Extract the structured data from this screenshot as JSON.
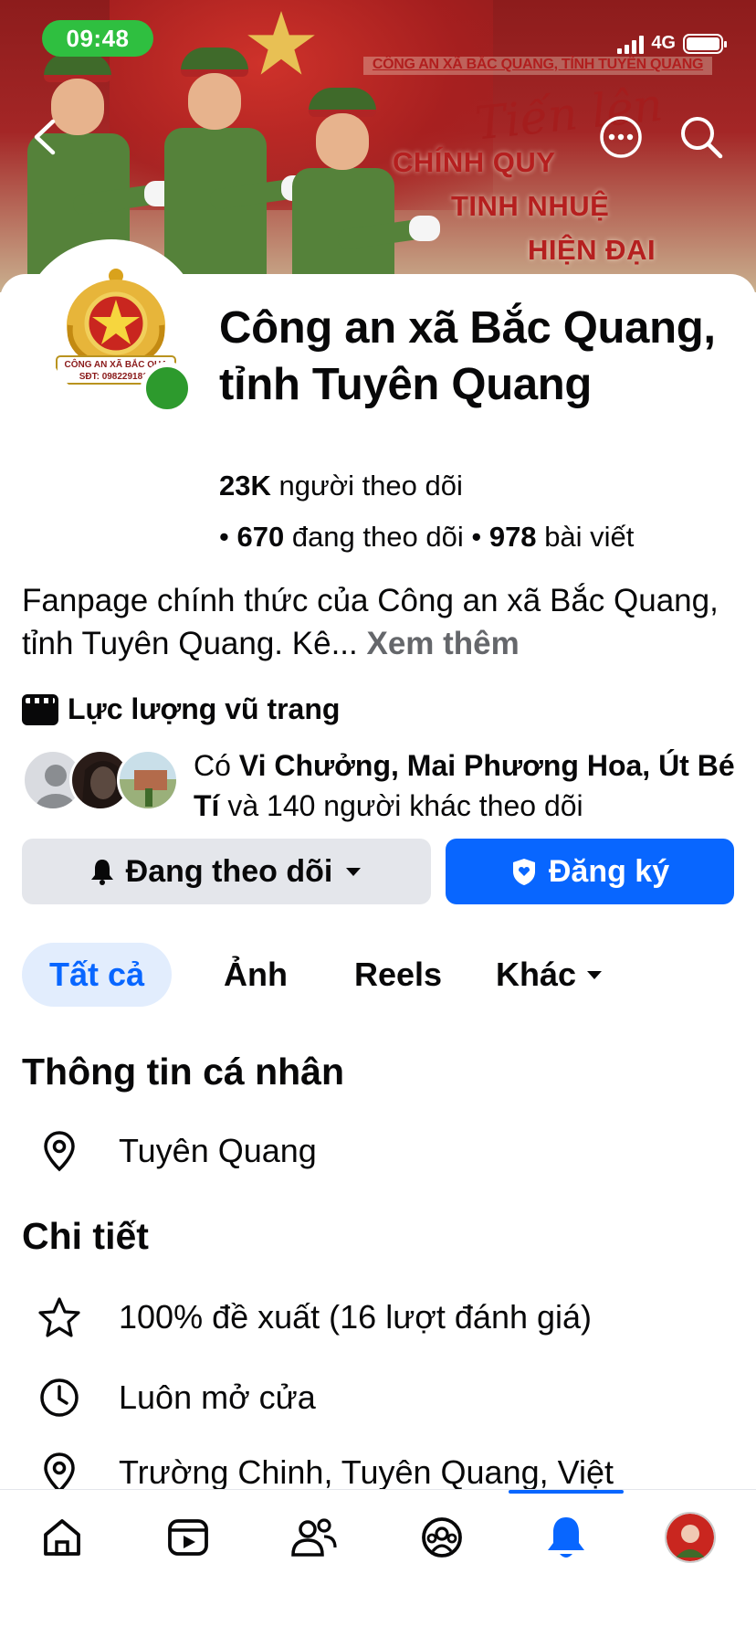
{
  "status_bar": {
    "time": "09:48",
    "network": "4G"
  },
  "cover": {
    "banner": "CÔNG AN XÃ BẮC QUANG, TỈNH TUYÊN QUANG",
    "script": "Tiến lên",
    "slogan": [
      "CHÍNH QUY",
      "TINH NHUỆ",
      "HIỆN ĐẠI"
    ]
  },
  "avatar": {
    "line1": "CÔNG AN XÃ BẮC QUA",
    "line2": "SĐT: 0982291819"
  },
  "page": {
    "name": "Công an xã Bắc Quang, tỉnh Tuyên Quang",
    "followers_count": "23K",
    "followers_label": "người theo dõi",
    "following_count": "670",
    "following_label": "đang theo dõi",
    "posts_count": "978",
    "posts_label": "bài viết"
  },
  "bio": {
    "text": "Fanpage chính thức của Công an xã Bắc Quang, tỉnh Tuyên Quang. Kê...",
    "see_more": "Xem thêm"
  },
  "category": "Lực lượng vũ trang",
  "mutuals": {
    "prefix": "Có",
    "names": "Vi Chưởng, Mai Phương Hoa, Út Bé Tí",
    "suffix": "và 140 người khác theo dõi"
  },
  "buttons": {
    "following": "Đang theo dõi",
    "subscribe": "Đăng ký"
  },
  "tabs": [
    {
      "label": "Tất cả",
      "active": true
    },
    {
      "label": "Ảnh"
    },
    {
      "label": "Reels"
    },
    {
      "label": "Khác"
    }
  ],
  "personal_info": {
    "title": "Thông tin cá nhân",
    "location": "Tuyên Quang"
  },
  "details": {
    "title": "Chi tiết",
    "rating": "100% đề xuất (16 lượt đánh giá)",
    "hours": "Luôn mở cửa",
    "address": "Trường Chinh, Tuyên Quang, Việt"
  },
  "icons": {
    "back": "chevron-left-icon",
    "more": "more-horizontal-icon",
    "search": "search-icon",
    "location": "map-pin-icon",
    "rating": "star-icon",
    "hours": "clock-icon",
    "home": "home-icon",
    "video": "video-icon",
    "friends": "friends-icon",
    "groups": "groups-icon",
    "notifications": "bell-icon"
  },
  "colors": {
    "primary": "#0866ff",
    "online": "#2d9a2d",
    "status_pill": "#2fbf40"
  }
}
